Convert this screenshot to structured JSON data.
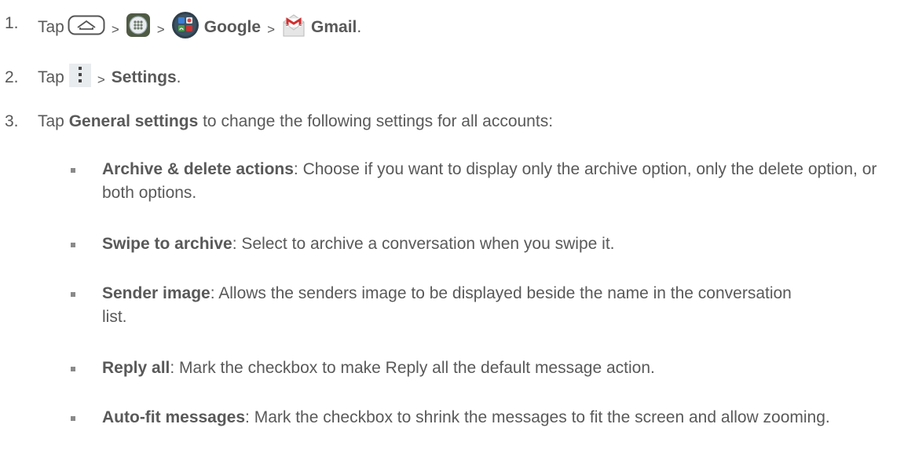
{
  "steps": [
    {
      "num": "1.",
      "tap": "Tap",
      "sep": ">",
      "google": "Google",
      "gmail": "Gmail",
      "end": ".",
      "icons": [
        "home-key-icon",
        "apps-icon",
        "google-folder-icon",
        "gmail-icon"
      ]
    },
    {
      "num": "2.",
      "tap": "Tap",
      "sep": ">",
      "settings": "Settings",
      "end": ".",
      "icons": [
        "menu-icon"
      ]
    },
    {
      "num": "3.",
      "tap": "Tap",
      "general": "General settings",
      "rest": " to change the following settings for all accounts:"
    }
  ],
  "bullets": [
    {
      "term": "Archive & delete actions",
      "desc": ": Choose if you want to display only the archive option, only the delete option, or both options."
    },
    {
      "term": "Swipe to archive",
      "desc": ": Select to archive a conversation when you swipe it."
    },
    {
      "term": "Sender image",
      "desc": ": Allows the senders image to be displayed beside the name in the conversation list."
    },
    {
      "term": "Reply all",
      "desc": ": Mark the checkbox to make Reply all the default message action."
    },
    {
      "term": "Auto-fit messages",
      "desc": ": Mark the checkbox to shrink the messages to fit the screen and allow zooming."
    }
  ]
}
